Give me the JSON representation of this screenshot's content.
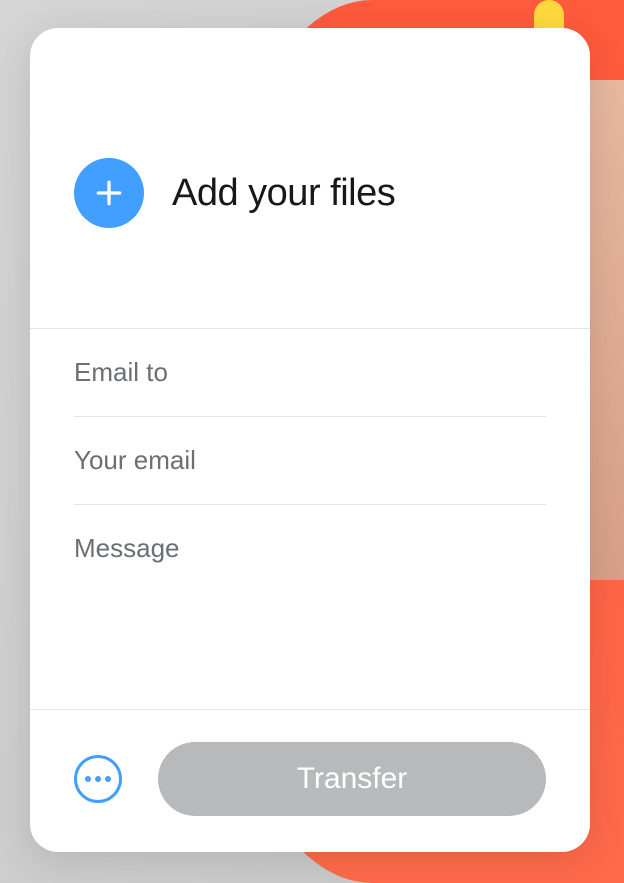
{
  "upload": {
    "title": "Add your files"
  },
  "form": {
    "email_to_placeholder": "Email to",
    "email_to_value": "",
    "your_email_placeholder": "Your email",
    "your_email_value": "",
    "message_placeholder": "Message",
    "message_value": ""
  },
  "footer": {
    "transfer_label": "Transfer"
  }
}
